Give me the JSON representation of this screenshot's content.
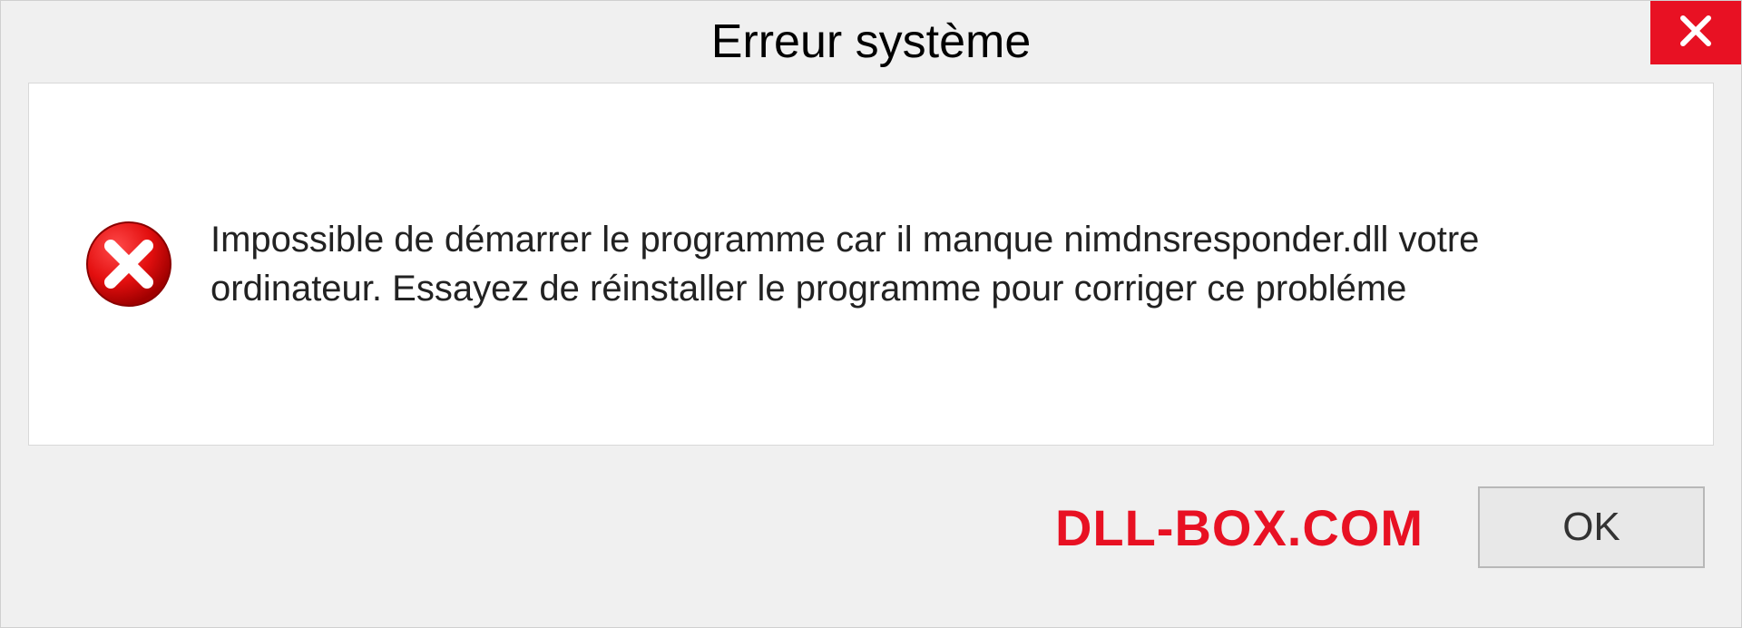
{
  "titlebar": {
    "title": "Erreur système"
  },
  "content": {
    "message": "Impossible de démarrer le programme car il manque nimdnsresponder.dll votre ordinateur. Essayez de réinstaller le programme pour corriger ce probléme"
  },
  "footer": {
    "brand": "DLL-BOX.COM",
    "ok_label": "OK"
  },
  "colors": {
    "accent_red": "#e81123",
    "dialog_bg": "#f0f0f0",
    "panel_bg": "#ffffff"
  }
}
